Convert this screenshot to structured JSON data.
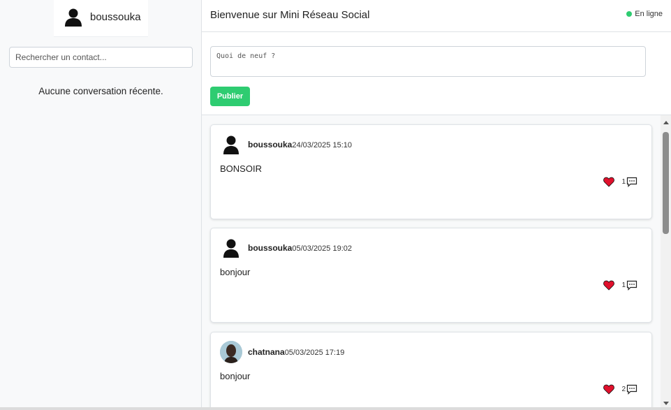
{
  "sidebar": {
    "user": {
      "name": "boussouka",
      "avatar_icon": "user-silhouette-icon"
    },
    "search": {
      "placeholder": "Rechercher un contact..."
    },
    "empty_message": "Aucune conversation récente."
  },
  "header": {
    "title": "Bienvenue sur Mini Réseau Social",
    "status": "En ligne",
    "status_color": "#2ecc71"
  },
  "composer": {
    "placeholder": "Quoi de neuf ?",
    "publish_label": "Publier",
    "accent": "#2ecc71"
  },
  "posts": [
    {
      "author": "boussouka",
      "date": "24/03/2025 15:10",
      "content": "BONSOIR",
      "avatar": "user-silhouette-icon",
      "likes_icon": "heart-icon",
      "comments": "1"
    },
    {
      "author": "boussouka",
      "date": "05/03/2025 19:02",
      "content": "bonjour",
      "avatar": "user-silhouette-icon",
      "likes_icon": "heart-icon",
      "comments": "1"
    },
    {
      "author": "chatnana",
      "date": "05/03/2025 17:19",
      "content": "bonjour",
      "avatar": "photo-avatar",
      "likes_icon": "heart-icon",
      "comments": "2"
    }
  ]
}
